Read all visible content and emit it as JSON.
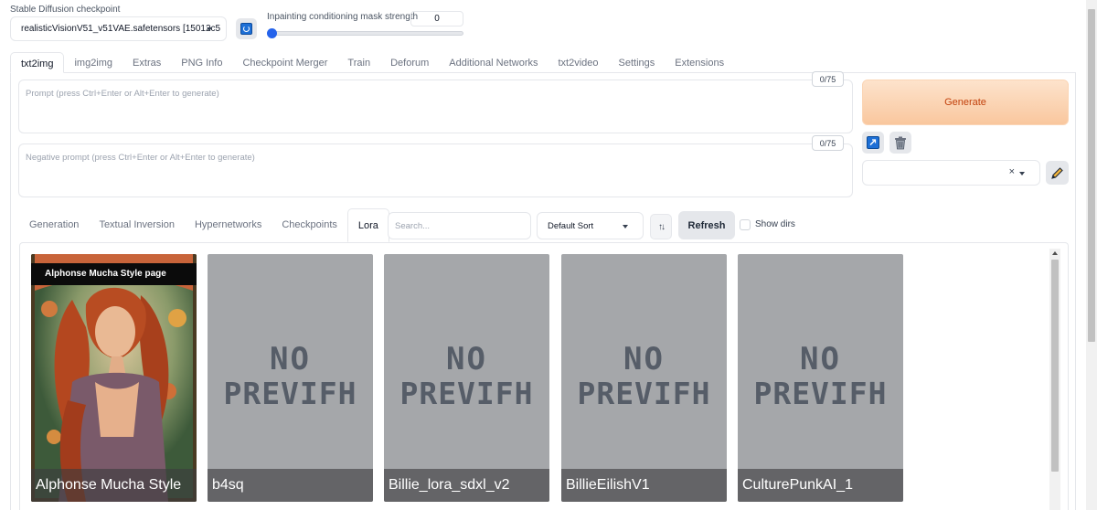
{
  "checkpoint": {
    "label": "Stable Diffusion checkpoint",
    "value": "realisticVisionV51_v51VAE.safetensors [15012c5"
  },
  "mask_strength": {
    "label": "Inpainting conditioning mask strength",
    "value": "0",
    "slider_fraction": 0
  },
  "main_tabs": [
    "txt2img",
    "img2img",
    "Extras",
    "PNG Info",
    "Checkpoint Merger",
    "Train",
    "Deforum",
    "Additional Networks",
    "txt2video",
    "Settings",
    "Extensions"
  ],
  "active_main_tab": "txt2img",
  "prompt": {
    "placeholder": "Prompt (press Ctrl+Enter or Alt+Enter to generate)",
    "token_count": "0/75"
  },
  "negative_prompt": {
    "placeholder": "Negative prompt (press Ctrl+Enter or Alt+Enter to generate)",
    "token_count": "0/75"
  },
  "generate_label": "Generate",
  "style_select": {
    "clear_glyph": "×"
  },
  "extra_networks": {
    "tabs": [
      "Generation",
      "Textual Inversion",
      "Hypernetworks",
      "Checkpoints",
      "Lora"
    ],
    "active_tab": "Lora",
    "search_placeholder": "Search...",
    "sort_value": "Default Sort",
    "sort_dir_glyph": "↑↓",
    "refresh_label": "Refresh",
    "show_dirs_label": "Show dirs",
    "cards": [
      {
        "name": "Alphonse Mucha Style",
        "banner": "Alphonse Mucha Style page",
        "has_preview": true
      },
      {
        "name": "b4sq",
        "has_preview": false,
        "placeholder_line1": "NO",
        "placeholder_line2": "PREVIFH"
      },
      {
        "name": "Billie_lora_sdxl_v2",
        "has_preview": false,
        "placeholder_line1": "NO",
        "placeholder_line2": "PREVIFH"
      },
      {
        "name": "BillieEilishV1",
        "has_preview": false,
        "placeholder_line1": "NO",
        "placeholder_line2": "PREVIFH"
      },
      {
        "name": "CulturePunkAI_1",
        "has_preview": false,
        "placeholder_line1": "NO",
        "placeholder_line2": "PREVIFH"
      }
    ]
  },
  "colors": {
    "generate_bg": "#f9c79e",
    "generate_text": "#c2410c",
    "slider_accent": "#2563eb"
  }
}
